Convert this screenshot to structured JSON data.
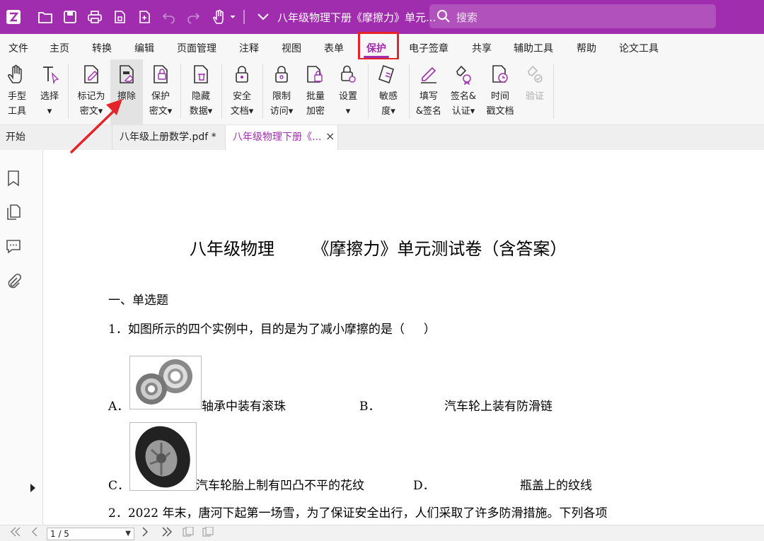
{
  "titlebar": {
    "document_title": "八年级物理下册《摩擦力》单元...",
    "search_placeholder": "搜索"
  },
  "menu": [
    "文件",
    "主页",
    "转换",
    "编辑",
    "页面管理",
    "注释",
    "视图",
    "表单",
    "保护",
    "电子签章",
    "共享",
    "辅助工具",
    "帮助",
    "论文工具"
  ],
  "active_menu": "保护",
  "ribbon": [
    {
      "line1": "手型",
      "line2": "工具",
      "icon": "hand-icon"
    },
    {
      "line1": "选择",
      "line2": "▾",
      "icon": "text-select-icon"
    },
    {
      "line1": "标记为",
      "line2": "密文▾",
      "icon": "mark-redact-icon"
    },
    {
      "line1": "擦除",
      "line2": "",
      "icon": "erase-icon"
    },
    {
      "line1": "保护",
      "line2": "密文▾",
      "icon": "protect-redact-icon"
    },
    {
      "line1": "隐藏",
      "line2": "数据▾",
      "icon": "hide-data-icon"
    },
    {
      "line1": "安全",
      "line2": "文档▾",
      "icon": "lock-icon"
    },
    {
      "line1": "限制",
      "line2": "访问▾",
      "icon": "restrict-access-icon"
    },
    {
      "line1": "批量",
      "line2": "加密",
      "icon": "batch-encrypt-icon"
    },
    {
      "line1": "设置",
      "line2": "▾",
      "icon": "settings-lock-icon"
    },
    {
      "line1": "敏感",
      "line2": "度▾",
      "icon": "sensitivity-icon"
    },
    {
      "line1": "填写",
      "line2": "&签名",
      "icon": "pen-icon"
    },
    {
      "line1": "签名&",
      "line2": "认证▾",
      "icon": "certify-icon"
    },
    {
      "line1": "时间",
      "line2": "戳文档",
      "icon": "timestamp-icon"
    },
    {
      "line1": "验证",
      "line2": "",
      "icon": "verify-icon"
    }
  ],
  "tabs": {
    "start": "开始",
    "tab1": "八年级上册数学.pdf *",
    "tab2": "八年级物理下册《...",
    "close": "×"
  },
  "document": {
    "title": "八年级物理       《摩擦力》单元测试卷（含答案）",
    "section": "一、单选题",
    "q1": "1．如图所示的四个实例中，目的是为了减小摩擦的是（     ）",
    "optA_label": "A．",
    "optA_text": "轴承中装有滚珠",
    "optB_label": "B．",
    "optB_text": "汽车轮上装有防滑链",
    "optC_label": "C．",
    "optC_text": "汽车轮胎上制有凹凸不平的花纹",
    "optD_label": "D．",
    "optD_text": "瓶盖上的纹线",
    "q2": "2．2022 年末，唐河下起第一场雪，为了保证安全出行，人们采取了许多防滑措施。下列各项"
  },
  "statusbar": {
    "page": "1 / 5"
  },
  "colors": {
    "accent": "#a02dae",
    "highlight_box": "#e3242b"
  }
}
